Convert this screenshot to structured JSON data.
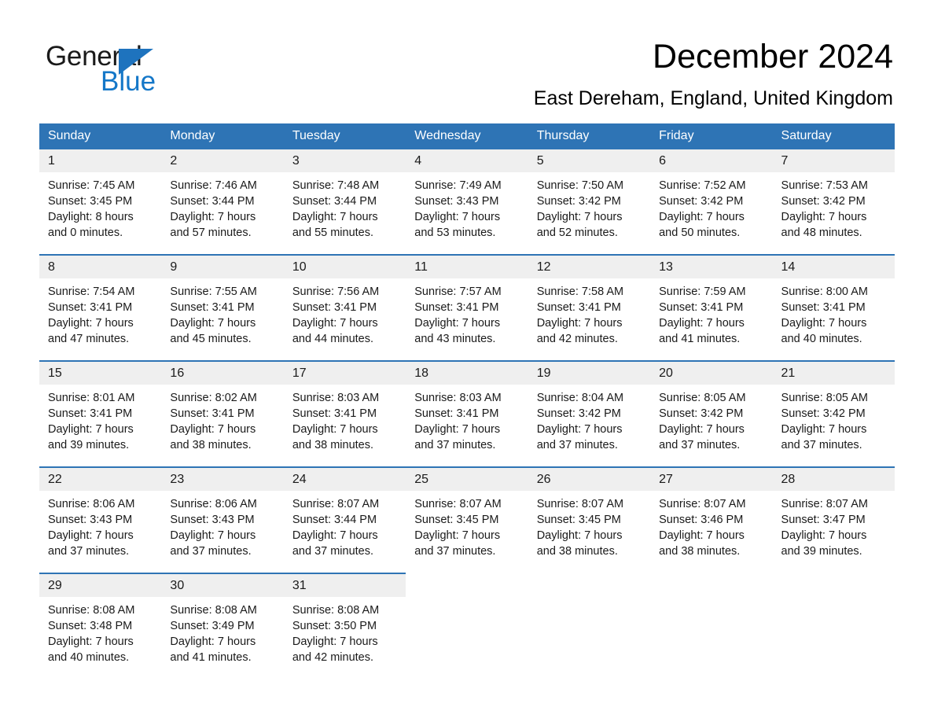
{
  "brand": {
    "name_part1": "General",
    "name_part2": "Blue",
    "logo_icon": "triangle-icon"
  },
  "header": {
    "month_title": "December 2024",
    "location": "East Dereham, England, United Kingdom"
  },
  "colors": {
    "header_blue": "#2e74b5",
    "brand_blue": "#1477c8",
    "daynum_band": "#efefef",
    "text": "#1a1a1a"
  },
  "weekdays": [
    "Sunday",
    "Monday",
    "Tuesday",
    "Wednesday",
    "Thursday",
    "Friday",
    "Saturday"
  ],
  "weeks": [
    {
      "days": [
        {
          "date": "1",
          "sunrise": "Sunrise: 7:45 AM",
          "sunset": "Sunset: 3:45 PM",
          "daylight_line1": "Daylight: 8 hours",
          "daylight_line2": "and 0 minutes."
        },
        {
          "date": "2",
          "sunrise": "Sunrise: 7:46 AM",
          "sunset": "Sunset: 3:44 PM",
          "daylight_line1": "Daylight: 7 hours",
          "daylight_line2": "and 57 minutes."
        },
        {
          "date": "3",
          "sunrise": "Sunrise: 7:48 AM",
          "sunset": "Sunset: 3:44 PM",
          "daylight_line1": "Daylight: 7 hours",
          "daylight_line2": "and 55 minutes."
        },
        {
          "date": "4",
          "sunrise": "Sunrise: 7:49 AM",
          "sunset": "Sunset: 3:43 PM",
          "daylight_line1": "Daylight: 7 hours",
          "daylight_line2": "and 53 minutes."
        },
        {
          "date": "5",
          "sunrise": "Sunrise: 7:50 AM",
          "sunset": "Sunset: 3:42 PM",
          "daylight_line1": "Daylight: 7 hours",
          "daylight_line2": "and 52 minutes."
        },
        {
          "date": "6",
          "sunrise": "Sunrise: 7:52 AM",
          "sunset": "Sunset: 3:42 PM",
          "daylight_line1": "Daylight: 7 hours",
          "daylight_line2": "and 50 minutes."
        },
        {
          "date": "7",
          "sunrise": "Sunrise: 7:53 AM",
          "sunset": "Sunset: 3:42 PM",
          "daylight_line1": "Daylight: 7 hours",
          "daylight_line2": "and 48 minutes."
        }
      ]
    },
    {
      "days": [
        {
          "date": "8",
          "sunrise": "Sunrise: 7:54 AM",
          "sunset": "Sunset: 3:41 PM",
          "daylight_line1": "Daylight: 7 hours",
          "daylight_line2": "and 47 minutes."
        },
        {
          "date": "9",
          "sunrise": "Sunrise: 7:55 AM",
          "sunset": "Sunset: 3:41 PM",
          "daylight_line1": "Daylight: 7 hours",
          "daylight_line2": "and 45 minutes."
        },
        {
          "date": "10",
          "sunrise": "Sunrise: 7:56 AM",
          "sunset": "Sunset: 3:41 PM",
          "daylight_line1": "Daylight: 7 hours",
          "daylight_line2": "and 44 minutes."
        },
        {
          "date": "11",
          "sunrise": "Sunrise: 7:57 AM",
          "sunset": "Sunset: 3:41 PM",
          "daylight_line1": "Daylight: 7 hours",
          "daylight_line2": "and 43 minutes."
        },
        {
          "date": "12",
          "sunrise": "Sunrise: 7:58 AM",
          "sunset": "Sunset: 3:41 PM",
          "daylight_line1": "Daylight: 7 hours",
          "daylight_line2": "and 42 minutes."
        },
        {
          "date": "13",
          "sunrise": "Sunrise: 7:59 AM",
          "sunset": "Sunset: 3:41 PM",
          "daylight_line1": "Daylight: 7 hours",
          "daylight_line2": "and 41 minutes."
        },
        {
          "date": "14",
          "sunrise": "Sunrise: 8:00 AM",
          "sunset": "Sunset: 3:41 PM",
          "daylight_line1": "Daylight: 7 hours",
          "daylight_line2": "and 40 minutes."
        }
      ]
    },
    {
      "days": [
        {
          "date": "15",
          "sunrise": "Sunrise: 8:01 AM",
          "sunset": "Sunset: 3:41 PM",
          "daylight_line1": "Daylight: 7 hours",
          "daylight_line2": "and 39 minutes."
        },
        {
          "date": "16",
          "sunrise": "Sunrise: 8:02 AM",
          "sunset": "Sunset: 3:41 PM",
          "daylight_line1": "Daylight: 7 hours",
          "daylight_line2": "and 38 minutes."
        },
        {
          "date": "17",
          "sunrise": "Sunrise: 8:03 AM",
          "sunset": "Sunset: 3:41 PM",
          "daylight_line1": "Daylight: 7 hours",
          "daylight_line2": "and 38 minutes."
        },
        {
          "date": "18",
          "sunrise": "Sunrise: 8:03 AM",
          "sunset": "Sunset: 3:41 PM",
          "daylight_line1": "Daylight: 7 hours",
          "daylight_line2": "and 37 minutes."
        },
        {
          "date": "19",
          "sunrise": "Sunrise: 8:04 AM",
          "sunset": "Sunset: 3:42 PM",
          "daylight_line1": "Daylight: 7 hours",
          "daylight_line2": "and 37 minutes."
        },
        {
          "date": "20",
          "sunrise": "Sunrise: 8:05 AM",
          "sunset": "Sunset: 3:42 PM",
          "daylight_line1": "Daylight: 7 hours",
          "daylight_line2": "and 37 minutes."
        },
        {
          "date": "21",
          "sunrise": "Sunrise: 8:05 AM",
          "sunset": "Sunset: 3:42 PM",
          "daylight_line1": "Daylight: 7 hours",
          "daylight_line2": "and 37 minutes."
        }
      ]
    },
    {
      "days": [
        {
          "date": "22",
          "sunrise": "Sunrise: 8:06 AM",
          "sunset": "Sunset: 3:43 PM",
          "daylight_line1": "Daylight: 7 hours",
          "daylight_line2": "and 37 minutes."
        },
        {
          "date": "23",
          "sunrise": "Sunrise: 8:06 AM",
          "sunset": "Sunset: 3:43 PM",
          "daylight_line1": "Daylight: 7 hours",
          "daylight_line2": "and 37 minutes."
        },
        {
          "date": "24",
          "sunrise": "Sunrise: 8:07 AM",
          "sunset": "Sunset: 3:44 PM",
          "daylight_line1": "Daylight: 7 hours",
          "daylight_line2": "and 37 minutes."
        },
        {
          "date": "25",
          "sunrise": "Sunrise: 8:07 AM",
          "sunset": "Sunset: 3:45 PM",
          "daylight_line1": "Daylight: 7 hours",
          "daylight_line2": "and 37 minutes."
        },
        {
          "date": "26",
          "sunrise": "Sunrise: 8:07 AM",
          "sunset": "Sunset: 3:45 PM",
          "daylight_line1": "Daylight: 7 hours",
          "daylight_line2": "and 38 minutes."
        },
        {
          "date": "27",
          "sunrise": "Sunrise: 8:07 AM",
          "sunset": "Sunset: 3:46 PM",
          "daylight_line1": "Daylight: 7 hours",
          "daylight_line2": "and 38 minutes."
        },
        {
          "date": "28",
          "sunrise": "Sunrise: 8:07 AM",
          "sunset": "Sunset: 3:47 PM",
          "daylight_line1": "Daylight: 7 hours",
          "daylight_line2": "and 39 minutes."
        }
      ]
    },
    {
      "days": [
        {
          "date": "29",
          "sunrise": "Sunrise: 8:08 AM",
          "sunset": "Sunset: 3:48 PM",
          "daylight_line1": "Daylight: 7 hours",
          "daylight_line2": "and 40 minutes."
        },
        {
          "date": "30",
          "sunrise": "Sunrise: 8:08 AM",
          "sunset": "Sunset: 3:49 PM",
          "daylight_line1": "Daylight: 7 hours",
          "daylight_line2": "and 41 minutes."
        },
        {
          "date": "31",
          "sunrise": "Sunrise: 8:08 AM",
          "sunset": "Sunset: 3:50 PM",
          "daylight_line1": "Daylight: 7 hours",
          "daylight_line2": "and 42 minutes."
        },
        {
          "date": "",
          "sunrise": "",
          "sunset": "",
          "daylight_line1": "",
          "daylight_line2": ""
        },
        {
          "date": "",
          "sunrise": "",
          "sunset": "",
          "daylight_line1": "",
          "daylight_line2": ""
        },
        {
          "date": "",
          "sunrise": "",
          "sunset": "",
          "daylight_line1": "",
          "daylight_line2": ""
        },
        {
          "date": "",
          "sunrise": "",
          "sunset": "",
          "daylight_line1": "",
          "daylight_line2": ""
        }
      ]
    }
  ]
}
